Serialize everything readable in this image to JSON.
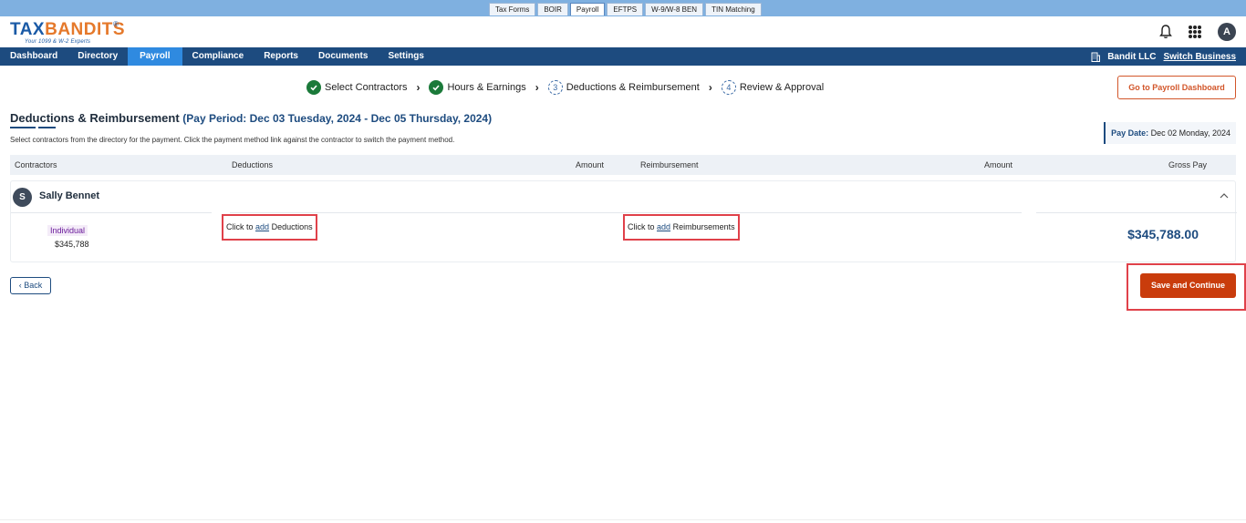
{
  "product_tabs": [
    {
      "label": "Tax Forms",
      "active": false
    },
    {
      "label": "BOIR",
      "active": false
    },
    {
      "label": "Payroll",
      "active": true
    },
    {
      "label": "EFTPS",
      "active": false
    },
    {
      "label": "W-9/W-8 BEN",
      "active": false
    },
    {
      "label": "TIN Matching",
      "active": false
    }
  ],
  "logo": {
    "part1": "TAX",
    "part2": "BANDITS",
    "reg": "®",
    "tagline": "Your 1099 & W-2 Experts"
  },
  "header": {
    "avatar_letter": "A"
  },
  "nav": {
    "items": [
      {
        "label": "Dashboard",
        "active": false
      },
      {
        "label": "Directory",
        "active": false
      },
      {
        "label": "Payroll",
        "active": true
      },
      {
        "label": "Compliance",
        "active": false
      },
      {
        "label": "Reports",
        "active": false
      },
      {
        "label": "Documents",
        "active": false
      },
      {
        "label": "Settings",
        "active": false
      }
    ],
    "business_name": "Bandit LLC",
    "switch_business": "Switch Business"
  },
  "stepper": {
    "steps": [
      {
        "label": "Select Contractors",
        "status": "done",
        "number": "1"
      },
      {
        "label": "Hours & Earnings",
        "status": "done",
        "number": "2"
      },
      {
        "label": "Deductions & Reimbursement",
        "status": "current",
        "number": "3"
      },
      {
        "label": "Review & Approval",
        "status": "pending",
        "number": "4"
      }
    ]
  },
  "go_dashboard_label": "Go to Payroll Dashboard",
  "page": {
    "title": "Deductions & Reimbursement",
    "period": "(Pay Period: Dec 03 Tuesday, 2024 - Dec 05 Thursday, 2024)",
    "subtitle": "Select contractors from the directory for the payment. Click the payment method link against the contractor to switch the payment method.",
    "pay_date_label": "Pay Date:",
    "pay_date_value": "Dec 02 Monday, 2024"
  },
  "table": {
    "headers": {
      "contractors": "Contractors",
      "deductions": "Deductions",
      "amount1": "Amount",
      "reimbursement": "Reimbursement",
      "amount2": "Amount",
      "gross_pay": "Gross Pay"
    }
  },
  "contractor": {
    "initial": "S",
    "name": "Sally Bennet",
    "type": "Individual",
    "amount": "$345,788",
    "deductions_prefix": "Click to",
    "deductions_link": "add",
    "deductions_suffix": "Deductions",
    "reimb_prefix": "Click to",
    "reimb_link": "add",
    "reimb_suffix": "Reimbursements",
    "gross_pay": "$345,788.00"
  },
  "buttons": {
    "back": "Back",
    "save_continue": "Save and Continue"
  },
  "colors": {
    "nav_bg": "#1d4b7f",
    "nav_active": "#2f8ae0",
    "accent_orange": "#c93c0c",
    "highlight_red": "#e0414a",
    "done_green": "#1b7a3a"
  }
}
